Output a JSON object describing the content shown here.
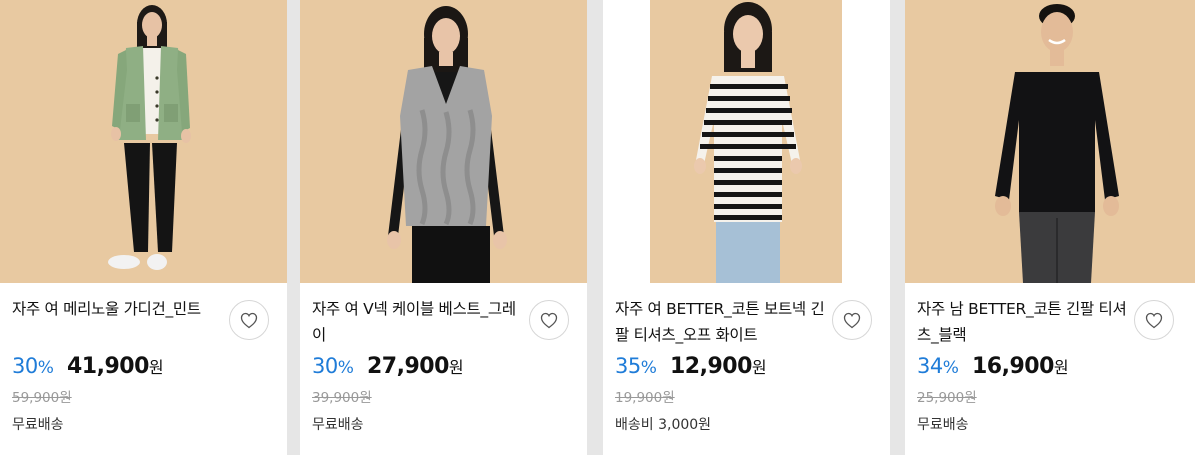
{
  "products": [
    {
      "title": "자주 여 메리노울 가디건_민트",
      "discount": "30",
      "discount_sign": "%",
      "price": "41,900",
      "currency": "원",
      "original_price": "59,900원",
      "shipping": "무료배송",
      "photo_icon": "model-mint-cardigan"
    },
    {
      "title": "자주 여 V넥 케이블 베스트_그레이",
      "discount": "30",
      "discount_sign": "%",
      "price": "27,900",
      "currency": "원",
      "original_price": "39,900원",
      "shipping": "무료배송",
      "photo_icon": "model-gray-vest"
    },
    {
      "title": "자주 여 BETTER_코튼 보트넥 긴팔 티셔츠_오프 화이트",
      "discount": "35",
      "discount_sign": "%",
      "price": "12,900",
      "currency": "원",
      "original_price": "19,900원",
      "shipping": "배송비 3,000원",
      "photo_icon": "model-striped-tee"
    },
    {
      "title": "자주 남 BETTER_코튼 긴팔 티셔츠_블랙",
      "discount": "34",
      "discount_sign": "%",
      "price": "16,900",
      "currency": "원",
      "original_price": "25,900원",
      "shipping": "무료배송",
      "photo_icon": "model-black-tee"
    }
  ],
  "icons": {
    "wishlist": "heart-icon"
  },
  "colors": {
    "discount": "#1f7cd8",
    "photo_background": "#e8c9a1",
    "card_background": "#ffffff",
    "page_background": "#e6e6e6"
  }
}
